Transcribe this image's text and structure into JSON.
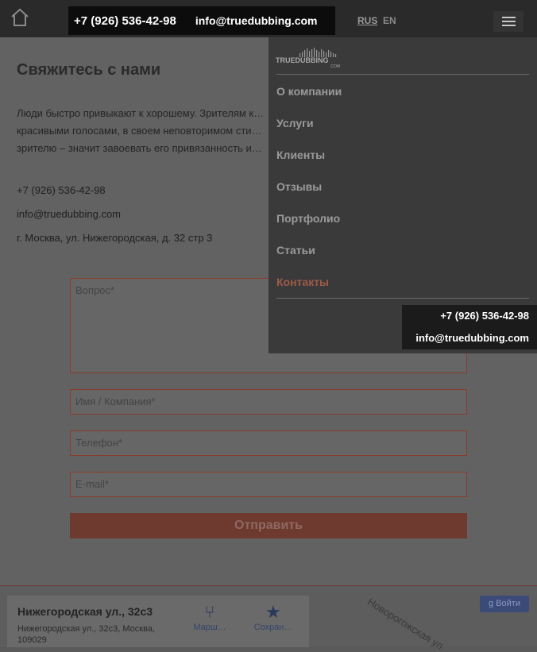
{
  "header": {
    "phone": "+7 (926) 536-42-98",
    "email": "info@truedubbing.com",
    "lang_ru": "RUS",
    "lang_en": "EN"
  },
  "page": {
    "title": "Свяжитесь с нами",
    "intro": "Люди быстро привыкают к хорошему. Зрителям к… красивыми голосами, в своем неповторимом сти… зрителю – значит завоевать его привязанность и…",
    "phone": "+7 (926) 536-42-98",
    "email": "info@truedubbing.com",
    "address": "г. Москва, ул. Нижегородская, д. 32 стр 3"
  },
  "form": {
    "question_placeholder": "Вопрос*",
    "name_placeholder": "Имя / Компания*",
    "phone_placeholder": "Телефон*",
    "email_placeholder": "E-mail*",
    "submit_label": "Отправить"
  },
  "map": {
    "address_title": "Нижегородская ул., 32с3",
    "address_sub": "Нижегородская ул., 32с3, Москва, 109029",
    "route_label": "Марш…",
    "save_label": "Сохран…",
    "street_label": "Новорогожская ул",
    "signin_label": "Войти"
  },
  "menu": {
    "logo_text": "TRUEDUBBING",
    "logo_sub": ".COM",
    "items": [
      {
        "label": "О компании"
      },
      {
        "label": "Услуги"
      },
      {
        "label": "Клиенты"
      },
      {
        "label": "Отзывы"
      },
      {
        "label": "Портфолио"
      },
      {
        "label": "Статьи"
      },
      {
        "label": "Контакты",
        "active": true
      }
    ],
    "phone": "+7 (926) 536-42-98",
    "email": "info@truedubbing.com"
  },
  "colors": {
    "accent": "#e0533a",
    "header_bg": "#2a2a2a",
    "menu_bg": "#3a3a3a"
  }
}
